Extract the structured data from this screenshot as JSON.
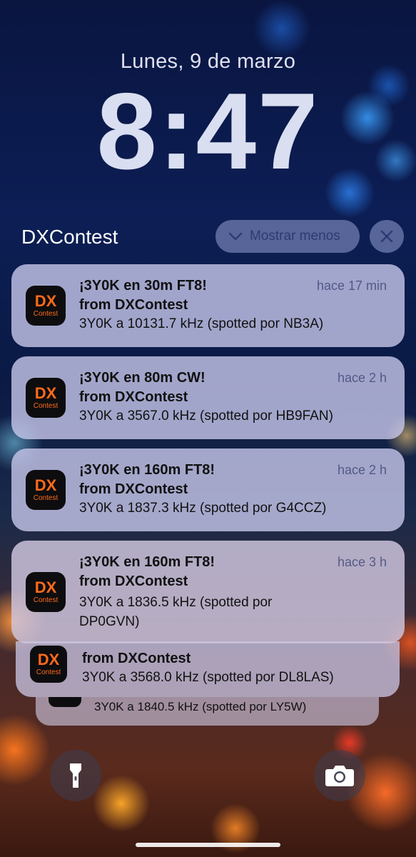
{
  "lockscreen": {
    "date": "Lunes, 9 de marzo",
    "time": "8:47"
  },
  "group": {
    "app_name": "DXContest",
    "show_less_label": "Mostrar menos",
    "close_icon": "close-icon"
  },
  "app_icon": {
    "dx": "DX",
    "contest": "Contest"
  },
  "notifications": [
    {
      "title": "¡3Y0K en 30m FT8!",
      "from": "from DXContest",
      "body": "3Y0K a 10131.7 kHz (spotted por NB3A)",
      "time": "hace 17 min"
    },
    {
      "title": "¡3Y0K en 80m CW!",
      "from": "from DXContest",
      "body": "3Y0K a 3567.0 kHz (spotted por HB9FAN)",
      "time": "hace 2 h"
    },
    {
      "title": "¡3Y0K en 160m FT8!",
      "from": "from DXContest",
      "body": "3Y0K a 1837.3 kHz (spotted por G4CCZ)",
      "time": "hace 2 h"
    },
    {
      "title": "¡3Y0K en 160m FT8!",
      "from": "from DXContest",
      "body": "3Y0K a 1836.5 kHz (spotted por DP0GVN)",
      "time": "hace 3 h"
    }
  ],
  "stacked": [
    {
      "from": "from DXContest",
      "body": "3Y0K a 3568.0 kHz (spotted por DL8LAS)"
    },
    {
      "body": "3Y0K a 1840.5 kHz (spotted por LY5W)"
    }
  ],
  "bottom_controls": {
    "left": "flashlight-icon",
    "right": "camera-icon"
  },
  "colors": {
    "app_icon_accent": "#ff6a1a",
    "app_icon_bg": "#0d0d0f"
  }
}
